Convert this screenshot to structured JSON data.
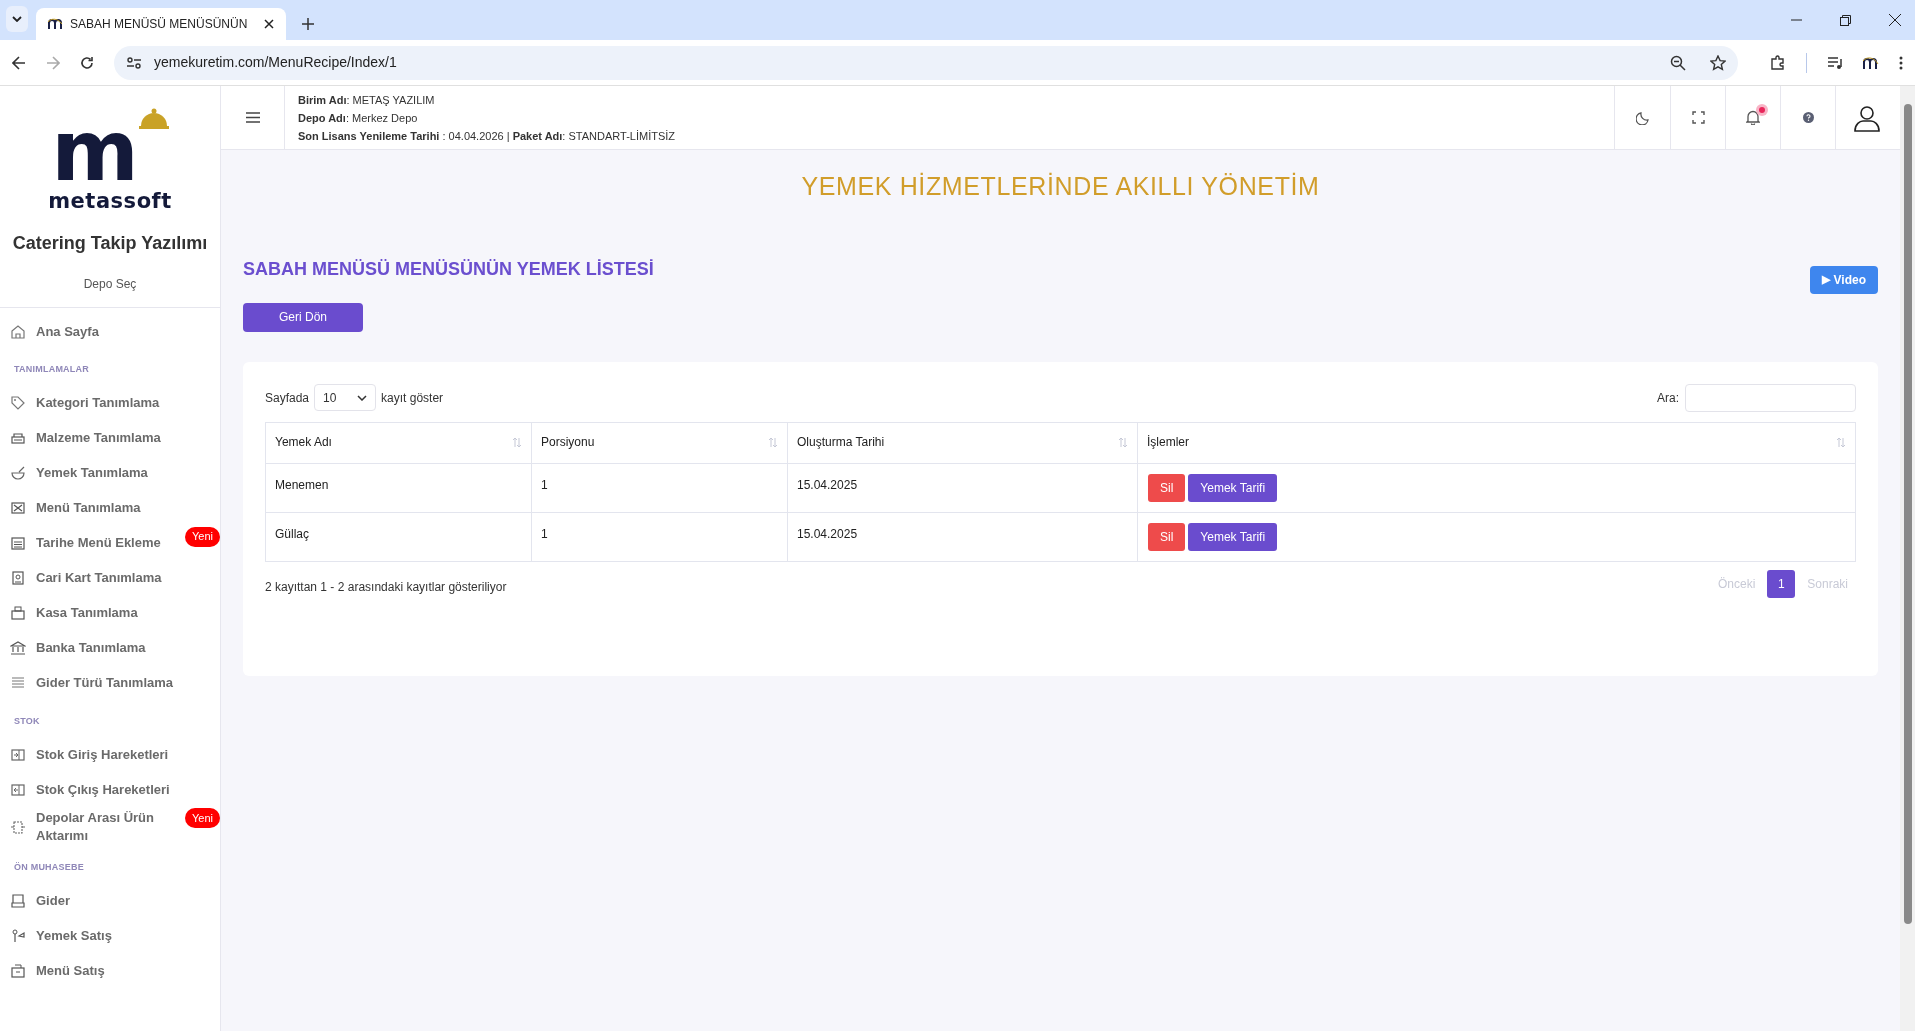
{
  "browser": {
    "tab_title": "SABAH MENÜSÜ MENÜSÜNÜN",
    "url": "yemekuretim.com/MenuRecipe/Index/1"
  },
  "sidebar": {
    "logo_letter": "m",
    "logo_word": "metassoft",
    "app_name": "Catering Takip Yazılımı",
    "depot_link": "Depo Seç",
    "items": [
      {
        "kind": "item",
        "label": "Ana Sayfa"
      },
      {
        "kind": "heading",
        "label": "TANIMLAMALAR"
      },
      {
        "kind": "item",
        "label": "Kategori Tanımlama"
      },
      {
        "kind": "item",
        "label": "Malzeme Tanımlama"
      },
      {
        "kind": "item",
        "label": "Yemek Tanımlama"
      },
      {
        "kind": "item",
        "label": "Menü Tanımlama"
      },
      {
        "kind": "item",
        "label": "Tarihe Menü Ekleme",
        "badge": "Yeni"
      },
      {
        "kind": "item",
        "label": "Cari Kart Tanımlama"
      },
      {
        "kind": "item",
        "label": "Kasa Tanımlama"
      },
      {
        "kind": "item",
        "label": "Banka Tanımlama"
      },
      {
        "kind": "item",
        "label": "Gider Türü Tanımlama"
      },
      {
        "kind": "heading",
        "label": "STOK"
      },
      {
        "kind": "item",
        "label": "Stok Giriş Hareketleri"
      },
      {
        "kind": "item",
        "label": "Stok Çıkış Hareketleri"
      },
      {
        "kind": "item",
        "label": "Depolar Arası Ürün Aktarımı",
        "badge": "Yeni"
      },
      {
        "kind": "heading",
        "label": "ÖN MUHASEBE"
      },
      {
        "kind": "item",
        "label": "Gider"
      },
      {
        "kind": "item",
        "label": "Yemek Satış"
      },
      {
        "kind": "item",
        "label": "Menü Satış"
      }
    ]
  },
  "header": {
    "info_lines": [
      "**Birim Adı**: METAŞ YAZILIM",
      "**Depo Adı**: Merkez Depo",
      "**Son Lisans Yenileme Tarihi** : 04.04.2026 | **Paket Adı**: STANDART-LİMİTSİZ"
    ],
    "notification_dot": true
  },
  "banner": "YEMEK HİZMETLERİNDE AKILLI YÖNETİM",
  "page_title": "SABAH MENÜSÜ MENÜSÜNÜN YEMEK LİSTESİ",
  "back_button": "Geri Dön",
  "video_button": {
    "icon": "▶",
    "label": "Video"
  },
  "table_controls": {
    "page_size_prefix": "Sayfada",
    "page_size": "10",
    "page_size_suffix": "kayıt göster",
    "search_label": "Ara:"
  },
  "table": {
    "columns": [
      "Yemek Adı",
      "Porsiyonu",
      "Oluşturma Tarihi",
      "İşlemler"
    ],
    "rows": [
      {
        "name": "Menemen",
        "portion": "1",
        "date": "15.04.2025",
        "actions": [
          "Sil",
          "Yemek Tarifi"
        ]
      },
      {
        "name": "Güllaç",
        "portion": "1",
        "date": "15.04.2025",
        "actions": [
          "Sil",
          "Yemek Tarifi"
        ]
      }
    ]
  },
  "info_text": "2 kayıttan 1 - 2 arasındaki kayıtlar gösteriliyor",
  "pagination": {
    "prev": {
      "label": "Önceki",
      "disabled": true
    },
    "pages": [
      {
        "label": "1",
        "selected": true
      }
    ],
    "next": {
      "label": "Sonraki",
      "disabled": true
    }
  }
}
